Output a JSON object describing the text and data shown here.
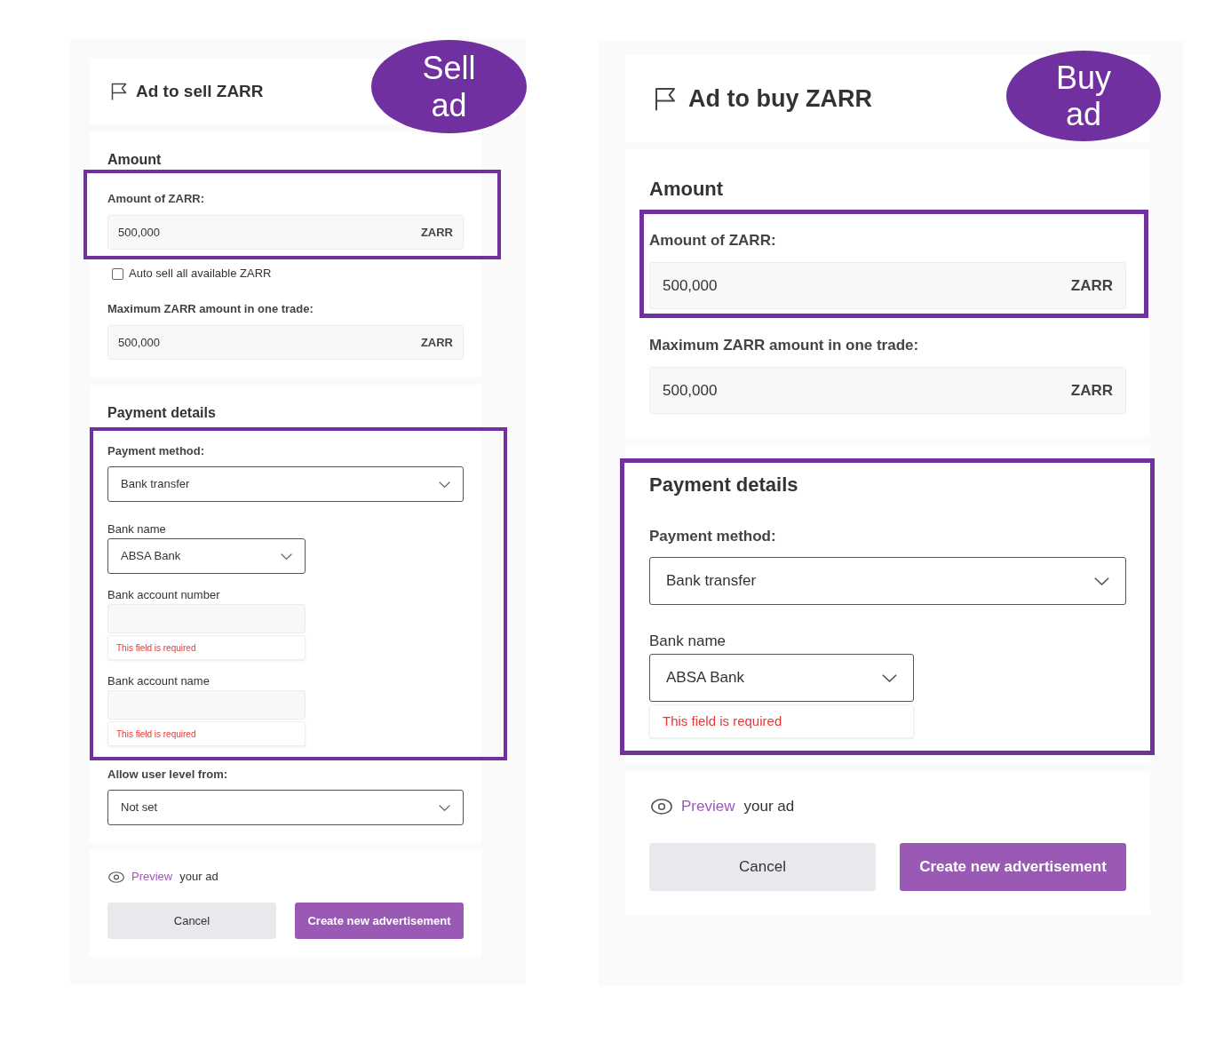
{
  "panels": [
    {
      "title": "Ad to sell ZARR",
      "badge": "Sell ad",
      "sections": [
        {
          "heading": "Amount",
          "highlighted": false,
          "groups": [
            {
              "highlighted": true,
              "fields": [
                {
                  "kind": "amount",
                  "label": "Amount of ZARR:",
                  "value": "500,000",
                  "unit": "ZARR"
                }
              ]
            },
            {
              "highlighted": false,
              "fields": [
                {
                  "kind": "checkbox",
                  "label": "Auto sell all available ZARR",
                  "checked": false
                },
                {
                  "kind": "amount",
                  "label": "Maximum ZARR amount in one trade:",
                  "value": "500,000",
                  "unit": "ZARR"
                }
              ]
            }
          ]
        },
        {
          "heading": "Payment details",
          "highlighted": false,
          "groups": [
            {
              "highlighted": true,
              "fields": [
                {
                  "kind": "select",
                  "label": "Payment method:",
                  "value": "Bank transfer"
                },
                {
                  "kind": "short-select",
                  "label": "Bank name",
                  "value": "ABSA Bank"
                },
                {
                  "kind": "short-input",
                  "label": "Bank account number",
                  "error": "This field is required"
                },
                {
                  "kind": "short-input",
                  "label": "Bank account name",
                  "error": "This field is required"
                }
              ]
            },
            {
              "highlighted": false,
              "fields": [
                {
                  "kind": "select",
                  "label": "Allow user level from:",
                  "value": "Not set"
                }
              ]
            }
          ]
        }
      ],
      "preview": {
        "link": "Preview",
        "text": "your ad"
      },
      "buttons": [
        {
          "kind": "secondary",
          "label": "Cancel"
        },
        {
          "kind": "primary",
          "label": "Create new advertisement"
        }
      ]
    },
    {
      "title": "Ad to buy ZARR",
      "badge": "Buy ad",
      "sections": [
        {
          "heading": "Amount",
          "highlighted": false,
          "groups": [
            {
              "highlighted": true,
              "fields": [
                {
                  "kind": "amount",
                  "label": "Amount of ZARR:",
                  "value": "500,000",
                  "unit": "ZARR"
                }
              ]
            },
            {
              "highlighted": false,
              "fields": [
                {
                  "kind": "amount",
                  "label": "Maximum ZARR amount in one trade:",
                  "value": "500,000",
                  "unit": "ZARR"
                }
              ]
            }
          ]
        },
        {
          "heading": "Payment details",
          "highlighted": true,
          "groups": [
            {
              "highlighted": false,
              "fields": [
                {
                  "kind": "select",
                  "label": "Payment method:",
                  "value": "Bank transfer"
                },
                {
                  "kind": "short-select",
                  "label": "Bank name",
                  "value": "ABSA Bank",
                  "error": "This field is required"
                }
              ]
            }
          ]
        }
      ],
      "preview": {
        "link": "Preview",
        "text": "your ad"
      },
      "buttons": [
        {
          "kind": "secondary",
          "label": "Cancel"
        },
        {
          "kind": "primary",
          "label": "Create new advertisement"
        }
      ]
    }
  ]
}
